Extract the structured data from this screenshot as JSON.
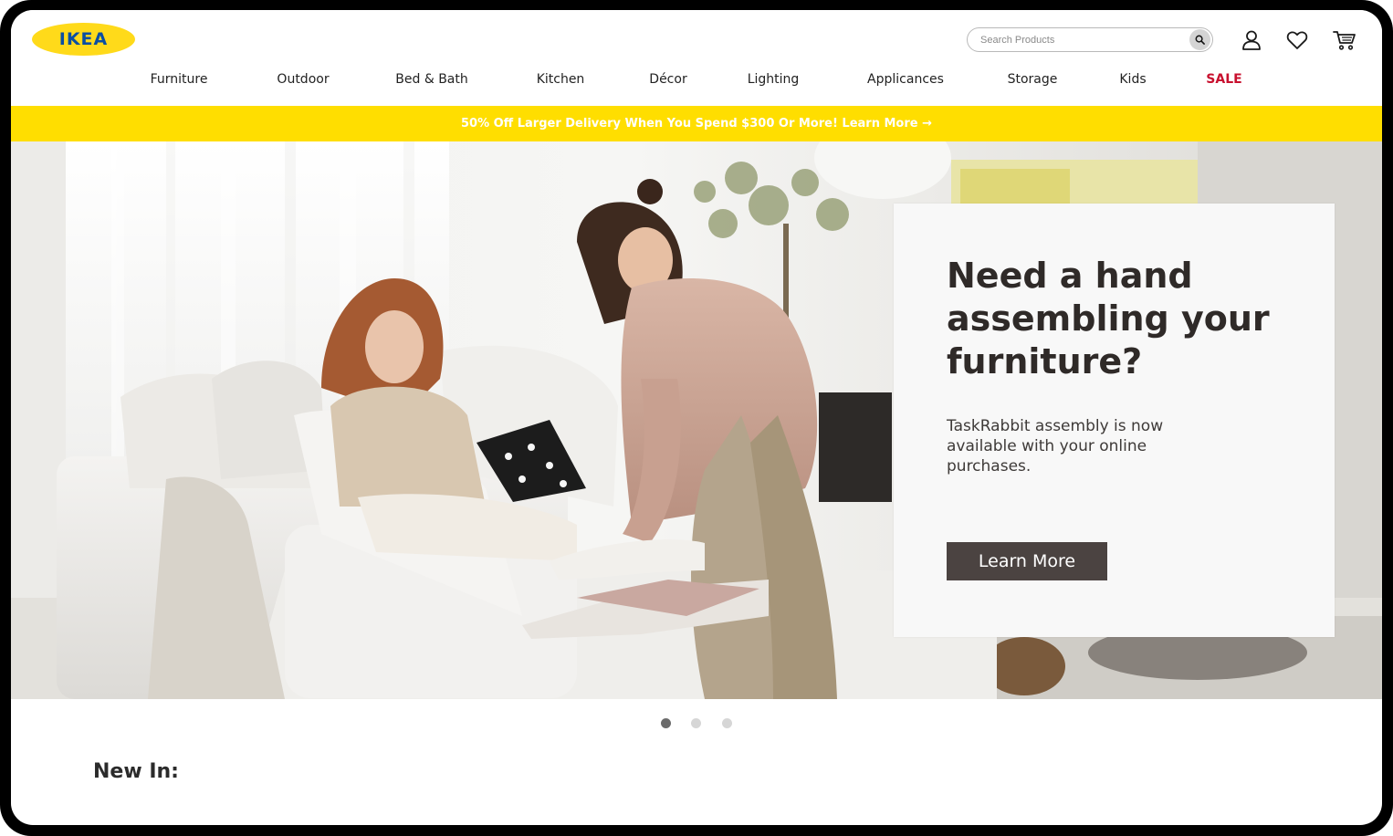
{
  "brand": {
    "logo_text": "IKEA",
    "logo_yellow": "#ffda1a",
    "logo_blue": "#0a4ea3"
  },
  "search": {
    "placeholder": "Search Products",
    "icon": "search-icon"
  },
  "header_icons": [
    "account-icon",
    "heart-icon",
    "cart-icon"
  ],
  "nav": {
    "items": [
      {
        "label": "Furniture"
      },
      {
        "label": "Outdoor"
      },
      {
        "label": "Bed & Bath"
      },
      {
        "label": "Kitchen"
      },
      {
        "label": "Décor"
      },
      {
        "label": "Lighting"
      },
      {
        "label": "Applicances"
      },
      {
        "label": "Storage"
      },
      {
        "label": "Kids"
      },
      {
        "label": "SALE",
        "color": "#c8102e"
      }
    ]
  },
  "promo": {
    "text": "50% Off Larger Delivery When You Spend $300 Or More! Learn More →",
    "background": "#ffde00"
  },
  "hero": {
    "headline": "Need a hand assembling your furniture?",
    "body": "TaskRabbit assembly is now available with your online purchases.",
    "cta_label": "Learn More",
    "cta_color": "#4b4341"
  },
  "carousel": {
    "slide_count": 3,
    "active_slide": 1
  },
  "section": {
    "new_in_title": "New In:"
  }
}
